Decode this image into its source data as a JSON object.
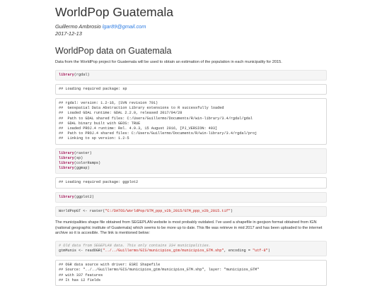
{
  "doc": {
    "title": "WorldPop Guatemala",
    "author_name": "Guillermo Ambrosio",
    "author_email": "lgar89@gmail.com",
    "date": "2017-12-13"
  },
  "section": {
    "heading": "WorldPop data on Guatemala",
    "intro": "Data from the WorldPop project for Guatemala will be used to obtain an estimation of the population in each municipality for 2015."
  },
  "blocks": {
    "c1_kw": "library",
    "c1_rest": "(rgdal)",
    "o1": "## Loading required package: sp",
    "o2": [
      "## rgdal: version: 1.2-16, (SVN revision 701)",
      "##  Geospatial Data Abstraction Library extensions to R successfully loaded",
      "##  Loaded GDAL runtime: GDAL 2.2.0, released 2017/04/28",
      "##  Path to GDAL shared files: C:/Users/Guillermo/Documents/R/win-library/3.4/rgdal/gdal",
      "##  GDAL binary built with GEOS: TRUE",
      "##  Loaded PROJ.4 runtime: Rel. 4.9.3, 15 August 2016, [PJ_VERSION: 493]",
      "##  Path to PROJ.4 shared files: C:/Users/Guillermo/Documents/R/win-library/3.4/rgdal/proj",
      "##  Linking to sp version: 1.2-5"
    ],
    "c3_kw": "library",
    "c3_args": [
      "(raster)",
      "(sp)",
      "(colorRamps)",
      "(ggmap)"
    ],
    "o3": "## Loading required package: ggplot2",
    "c4_kw": "library",
    "c4_rest": "(ggplot2)",
    "c5_pre": "WorldPopGT <- raster(",
    "c5_str": "\"C:/DATOS/WorldPop/GTM_ppp_v2b_2015/GTM_ppp_v2b_2015.tif\"",
    "c5_post": ")",
    "para2": "The municipalities shape file obtained from SEGEPLAN website is most probably outdated. I've used a shapefile in geojson format obtained from IGN (national geographic institute of Guatemala) which seems to be more up to date. This file was retrieve in mid 2017 and has been uploaded to the internet archive so it is accesible. The link is mentioned below:",
    "c6_comment": "# Old data from SEGEPLAN data. This only contains 334 municipalities.",
    "c6_pre": "gtmMunis <- readOGR(",
    "c6_str1": "\"../../Guillermo/GIS/municipios_gtm/municipios_GTM.shp\"",
    "c6_mid": ", encoding = ",
    "c6_str2": "\"utf-8\"",
    "c6_post": ")",
    "o6": [
      "## OGR data source with driver: ESRI Shapefile",
      "## Source: \"../../Guillermo/GIS/municipios_gtm/municipios_GTM.shp\", layer: \"municipios_GTM\"",
      "## with 337 features",
      "## It has 12 fields"
    ]
  }
}
